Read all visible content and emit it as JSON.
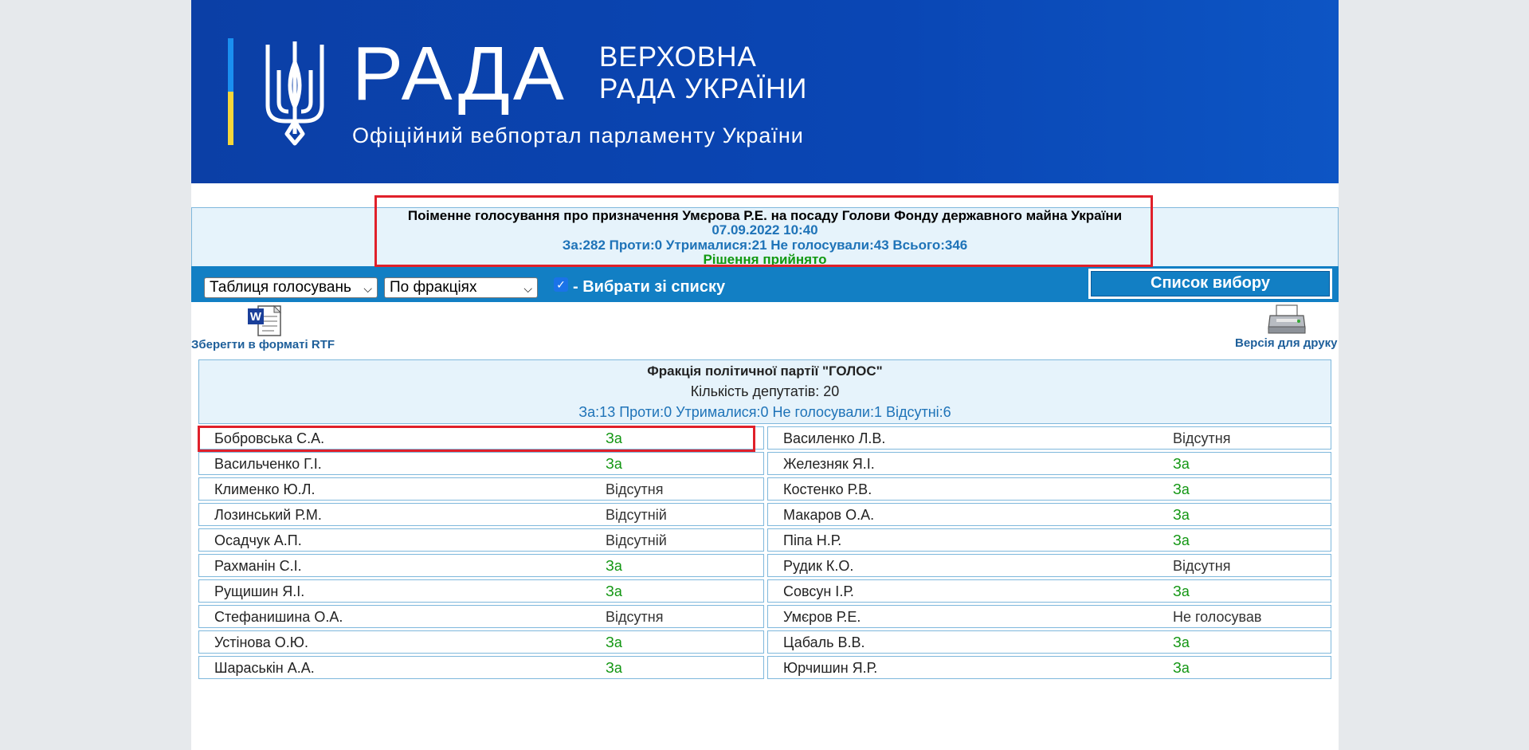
{
  "header": {
    "logo_word": "РАДА",
    "logo_sub1": "ВЕРХОВНА",
    "logo_sub2": "РАДА УКРАЇНИ",
    "tagline": "Офіційний вебпортал парламенту України",
    "colors": {
      "banner": "#0b3fa6",
      "flag_blue": "#1a8ff0",
      "flag_yellow": "#f6d63a"
    }
  },
  "vote": {
    "title": "Поіменне голосування про призначення Умєрова Р.Е. на посаду Голови Фонду державного майна України",
    "datetime": "07.09.2022 10:40",
    "totals": "За:282 Проти:0 Утрималися:21 Не голосували:43 Всього:346",
    "decision": "Рішення прийнято"
  },
  "toolbar": {
    "select_view": "Таблиця голосувань",
    "select_group": "По фракціях",
    "checkbox_checked": true,
    "checkbox_label": "- Вибрати зі списку",
    "list_button": "Список вибору"
  },
  "links": {
    "rtf_label": "Зберегти в форматі RTF",
    "rtf_icon": "word-document-icon",
    "print_label": "Версія для друку",
    "print_icon": "printer-icon"
  },
  "faction": {
    "name": "Фракція політичної партії \"ГОЛОС\"",
    "count": "Кількість депутатів: 20",
    "totals": "За:13 Проти:0 Утрималися:0 Не голосували:1 Відсутні:6"
  },
  "deputies_left": [
    {
      "name": "Бобровська С.А.",
      "vote": "За"
    },
    {
      "name": "Васильченко Г.І.",
      "vote": "За"
    },
    {
      "name": "Клименко Ю.Л.",
      "vote": "Відсутня"
    },
    {
      "name": "Лозинський Р.М.",
      "vote": "Відсутній"
    },
    {
      "name": "Осадчук А.П.",
      "vote": "Відсутній"
    },
    {
      "name": "Рахманін С.І.",
      "vote": "За"
    },
    {
      "name": "Рущишин Я.І.",
      "vote": "За"
    },
    {
      "name": "Стефанишина О.А.",
      "vote": "Відсутня"
    },
    {
      "name": "Устінова О.Ю.",
      "vote": "За"
    },
    {
      "name": "Шараськін А.А.",
      "vote": "За"
    }
  ],
  "deputies_right": [
    {
      "name": "Василенко Л.В.",
      "vote": "Відсутня"
    },
    {
      "name": "Железняк Я.І.",
      "vote": "За"
    },
    {
      "name": "Костенко Р.В.",
      "vote": "За"
    },
    {
      "name": "Макаров О.А.",
      "vote": "За"
    },
    {
      "name": "Піпа Н.Р.",
      "vote": "За"
    },
    {
      "name": "Рудик К.О.",
      "vote": "Відсутня"
    },
    {
      "name": "Совсун І.Р.",
      "vote": "За"
    },
    {
      "name": "Умєров Р.Е.",
      "vote": "Не голосував"
    },
    {
      "name": "Цабаль В.В.",
      "vote": "За"
    },
    {
      "name": "Юрчишин Я.Р.",
      "vote": "За"
    }
  ],
  "vote_colors": {
    "yes": "#129612",
    "other": "#333333"
  }
}
